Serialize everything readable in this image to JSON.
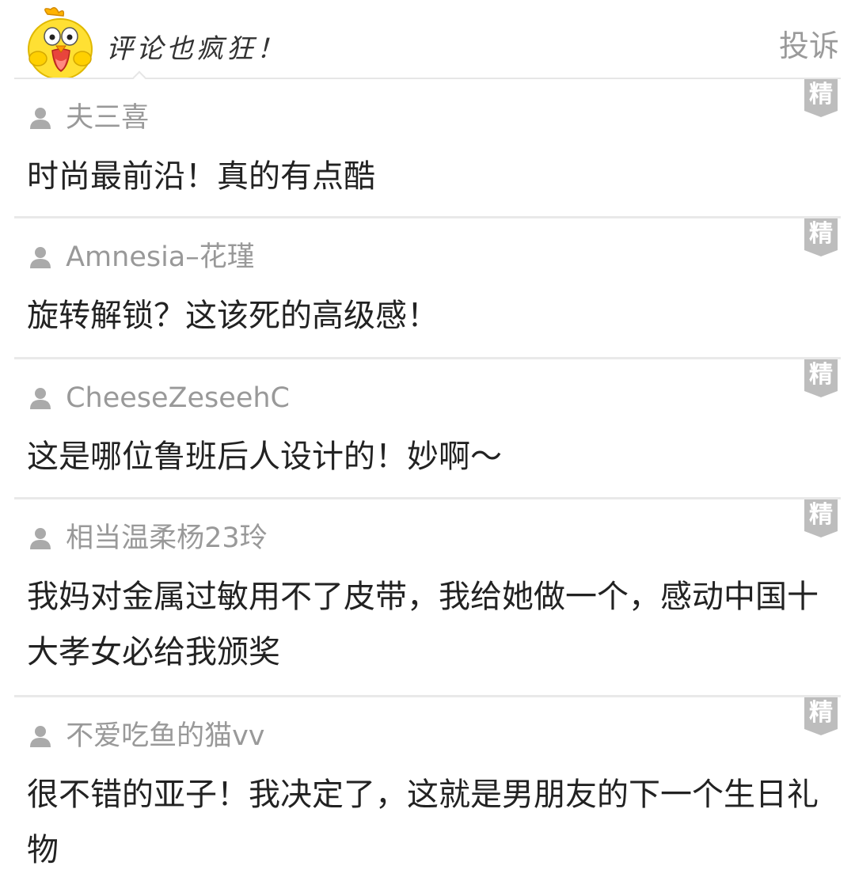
{
  "header": {
    "title": "评论也疯狂！",
    "report_label": "投诉"
  },
  "badge_label": "精",
  "icons": {
    "mascot": "yellow-bird-mascot-icon",
    "user": "user-silhouette-icon",
    "featured": "featured-ribbon-icon"
  },
  "colors": {
    "badge": "#bdbdbd",
    "username": "#999999",
    "text": "#222222",
    "divider": "#e9e9e9",
    "mascot": "#ffe033"
  },
  "comments": [
    {
      "username": "夫三喜",
      "text": "时尚最前沿！真的有点酷"
    },
    {
      "username": "Amnesia–花瑾",
      "text": "旋转解锁？这该死的高级感！"
    },
    {
      "username": "CheeseZeseehC",
      "text": "这是哪位鲁班后人设计的！妙啊～"
    },
    {
      "username": "相当温柔杨23玲",
      "text": "我妈对金属过敏用不了皮带，我给她做一个，感动中国十大孝女必给我颁奖"
    },
    {
      "username": "不爱吃鱼的猫vv",
      "text": "很不错的亚子！我决定了，这就是男朋友的下一个生日礼物"
    }
  ]
}
